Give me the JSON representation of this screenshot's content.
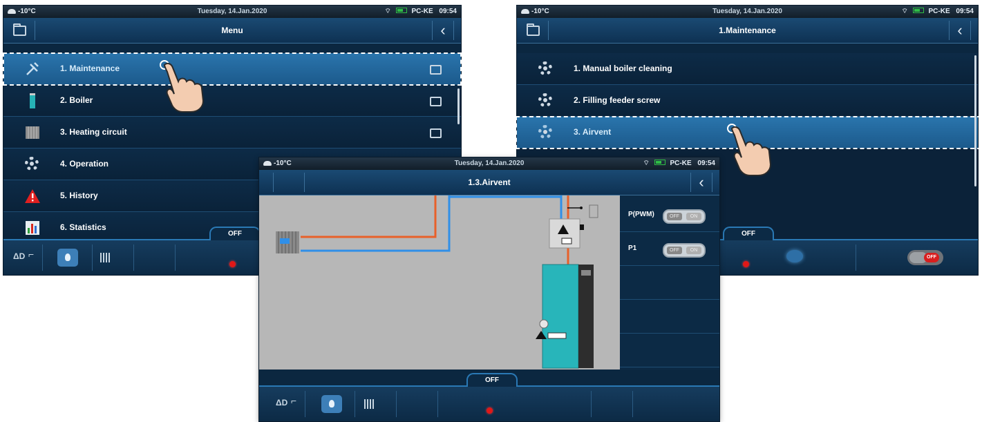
{
  "status": {
    "temperature": "-10°C",
    "date": "Tuesday, 14.Jan.2020",
    "device": "PC-KE",
    "time": "09:54"
  },
  "screen_menu": {
    "title": "Menu",
    "items": [
      {
        "label": "1. Maintenance",
        "icon": "tools-icon"
      },
      {
        "label": "2. Boiler",
        "icon": "boiler-icon"
      },
      {
        "label": "3. Heating circuit",
        "icon": "radiator-icon"
      },
      {
        "label": "4. Operation",
        "icon": "gear-icon"
      },
      {
        "label": "5. History",
        "icon": "warning-icon"
      },
      {
        "label": "6. Statistics",
        "icon": "statistics-icon"
      }
    ],
    "bottom": {
      "off_label": "OFF",
      "fuel_label": "ΔD"
    }
  },
  "screen_maintenance": {
    "title": "1.Maintenance",
    "items": [
      {
        "label": "1. Manual boiler cleaning",
        "icon": "gear-icon"
      },
      {
        "label": "2. Filling feeder screw",
        "icon": "gear-icon"
      },
      {
        "label": "3. Airvent",
        "icon": "gear-icon"
      }
    ],
    "bottom": {
      "off_label": "OFF"
    }
  },
  "screen_airvent": {
    "title": "1.3.Airvent",
    "controls": [
      {
        "label": "P(PWM)",
        "off": "OFF",
        "on": "ON"
      },
      {
        "label": "P1",
        "off": "OFF",
        "on": "ON"
      }
    ],
    "bottom": {
      "off_label": "OFF",
      "fuel_label": "ΔD"
    }
  },
  "colors": {
    "accent_blue": "#2a79b5",
    "hot_pipe": "#e8602a",
    "cold_pipe": "#2f8fe8",
    "boiler": "#27b3b8",
    "status_red": "#e01818"
  }
}
